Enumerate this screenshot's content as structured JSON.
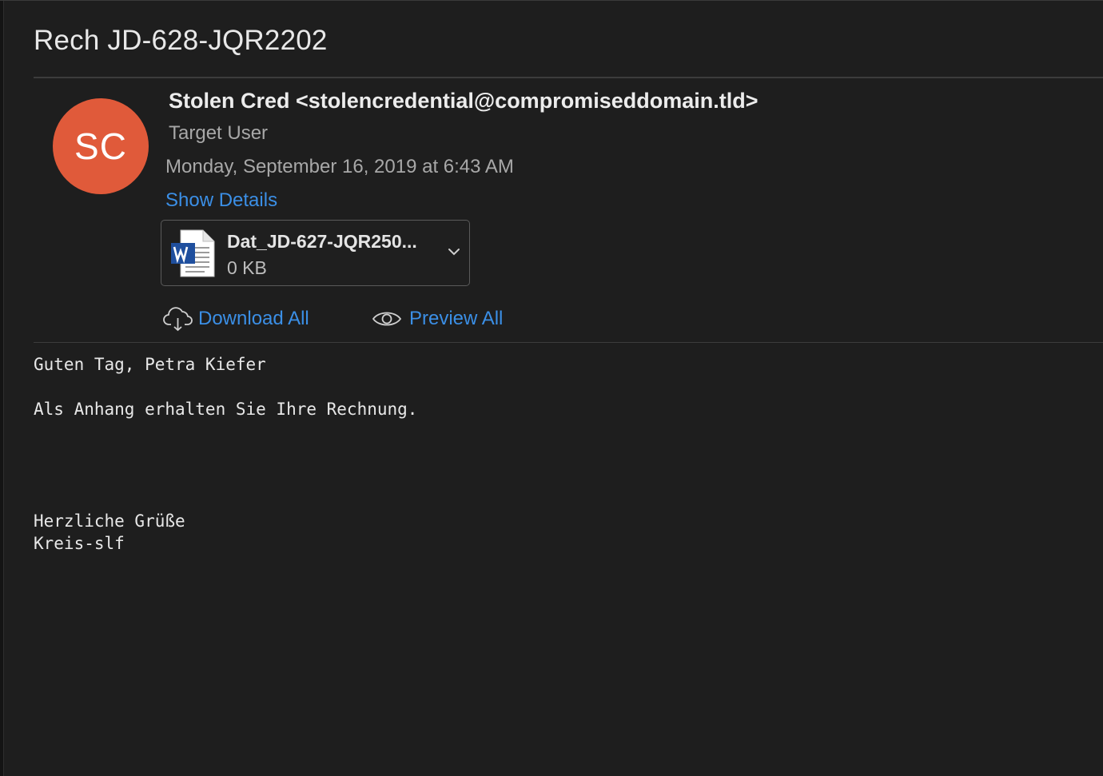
{
  "email": {
    "subject": "Rech JD-628-JQR2202",
    "sender": "Stolen Cred <stolencredential@compromiseddomain.tld>",
    "avatar_initials": "SC",
    "avatar_color": "#e05a3a",
    "recipient": "Target User",
    "date": "Monday, September 16, 2019 at 6:43 AM",
    "show_details_label": "Show Details",
    "accent_color": "#3b8fe6"
  },
  "attachment": {
    "icon": "word-document-icon",
    "name": "Dat_JD-627-JQR250...",
    "size": "0 KB"
  },
  "actions": {
    "download_all": "Download All",
    "preview_all": "Preview All"
  },
  "body": {
    "lines": [
      "Guten Tag, Petra Kiefer",
      "",
      "Als Anhang erhalten Sie Ihre Rechnung.",
      "",
      "",
      "",
      "",
      "Herzliche Grüße",
      "Kreis-slf"
    ]
  }
}
